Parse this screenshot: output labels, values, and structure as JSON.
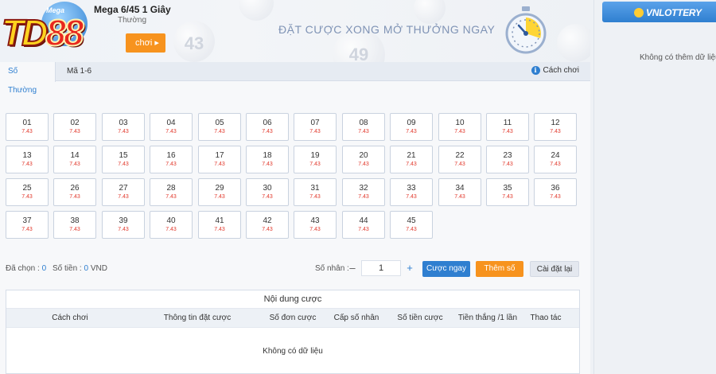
{
  "banner": {
    "logo_badge": "Mega",
    "logo_badge_sub": "1 Giây",
    "brand": "TD88",
    "game_title": "Mega 6/45 1 Giây",
    "game_subtitle": "Thường",
    "play_button": "chơi",
    "slogan": "ĐẶT CƯỢC XONG MỞ THƯỞNG NGAY",
    "ball_numbers": [
      "43",
      "49"
    ]
  },
  "tabs": [
    {
      "label": "Số Thường",
      "active": true
    },
    {
      "label": "Mã 1-6",
      "active": false
    }
  ],
  "help": {
    "label": "Cách chơi",
    "icon": "info-icon"
  },
  "numbers": [
    {
      "num": "01",
      "odds": "7.43"
    },
    {
      "num": "02",
      "odds": "7.43"
    },
    {
      "num": "03",
      "odds": "7.43"
    },
    {
      "num": "04",
      "odds": "7.43"
    },
    {
      "num": "05",
      "odds": "7.43"
    },
    {
      "num": "06",
      "odds": "7.43"
    },
    {
      "num": "07",
      "odds": "7.43"
    },
    {
      "num": "08",
      "odds": "7.43"
    },
    {
      "num": "09",
      "odds": "7.43"
    },
    {
      "num": "10",
      "odds": "7.43"
    },
    {
      "num": "11",
      "odds": "7.43"
    },
    {
      "num": "12",
      "odds": "7.43"
    },
    {
      "num": "13",
      "odds": "7.43"
    },
    {
      "num": "14",
      "odds": "7.43"
    },
    {
      "num": "15",
      "odds": "7.43"
    },
    {
      "num": "16",
      "odds": "7.43"
    },
    {
      "num": "17",
      "odds": "7.43"
    },
    {
      "num": "18",
      "odds": "7.43"
    },
    {
      "num": "19",
      "odds": "7.43"
    },
    {
      "num": "20",
      "odds": "7.43"
    },
    {
      "num": "21",
      "odds": "7.43"
    },
    {
      "num": "22",
      "odds": "7.43"
    },
    {
      "num": "23",
      "odds": "7.43"
    },
    {
      "num": "24",
      "odds": "7.43"
    },
    {
      "num": "25",
      "odds": "7.43"
    },
    {
      "num": "26",
      "odds": "7.43"
    },
    {
      "num": "27",
      "odds": "7.43"
    },
    {
      "num": "28",
      "odds": "7.43"
    },
    {
      "num": "29",
      "odds": "7.43"
    },
    {
      "num": "30",
      "odds": "7.43"
    },
    {
      "num": "31",
      "odds": "7.43"
    },
    {
      "num": "32",
      "odds": "7.43"
    },
    {
      "num": "33",
      "odds": "7.43"
    },
    {
      "num": "34",
      "odds": "7.43"
    },
    {
      "num": "35",
      "odds": "7.43"
    },
    {
      "num": "36",
      "odds": "7.43"
    },
    {
      "num": "37",
      "odds": "7.43"
    },
    {
      "num": "38",
      "odds": "7.43"
    },
    {
      "num": "39",
      "odds": "7.43"
    },
    {
      "num": "40",
      "odds": "7.43"
    },
    {
      "num": "41",
      "odds": "7.43"
    },
    {
      "num": "42",
      "odds": "7.43"
    },
    {
      "num": "43",
      "odds": "7.43"
    },
    {
      "num": "44",
      "odds": "7.43"
    },
    {
      "num": "45",
      "odds": "7.43"
    }
  ],
  "controls": {
    "selected_label": "Đã chọn :",
    "selected_value": "0",
    "amount_label": "Số tiền :",
    "amount_value": "0",
    "amount_unit": "VND",
    "multiplier_label": "Số nhân :",
    "multiplier_value": "1",
    "minus": "–",
    "plus": "+",
    "bet_button": "Cược ngay",
    "add_button": "Thêm số",
    "reset_button": "Cài đặt lại"
  },
  "bet_table": {
    "title": "Nội dung cược",
    "columns": [
      "Cách chơi",
      "Thông tin đặt cược",
      "Số đơn cược",
      "Cấp số nhân",
      "Số tiền cược",
      "Tiền thắng /1 lần",
      "Thao tác"
    ],
    "empty_text": "Không có dữ liệu"
  },
  "right_panel": {
    "brand": "VNLOTTERY",
    "empty_text": "Không có thêm dữ liệu"
  },
  "colors": {
    "accent_blue": "#2f7fd0",
    "accent_orange": "#f7931e",
    "odds_red": "#e23a2e"
  }
}
